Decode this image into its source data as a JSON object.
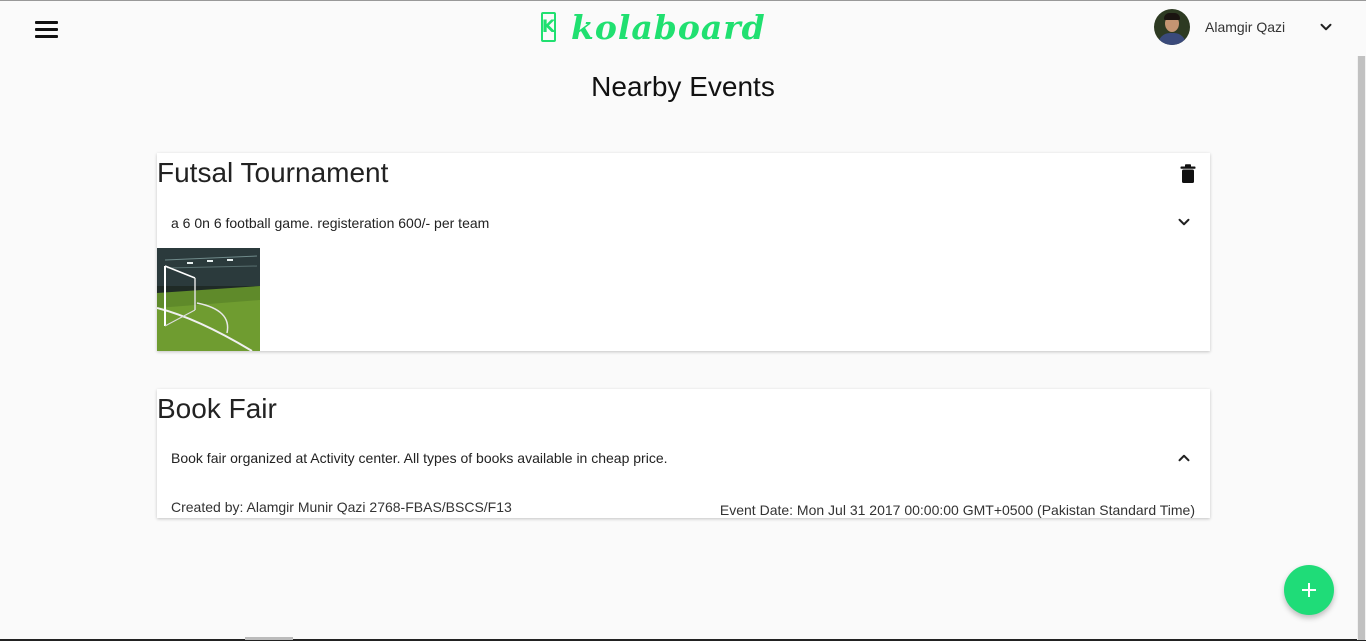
{
  "header": {
    "logo_mark": "K",
    "logo_text": "kolaboard",
    "user_name": "Alamgir Qazi",
    "menu_icon": "hamburger-menu-icon",
    "user_menu_icon": "chevron-down-icon"
  },
  "page": {
    "title": "Nearby Events"
  },
  "events": [
    {
      "title": "Futsal Tournament",
      "description": "a 6 0n 6 football game. registeration 600/- per team",
      "expanded": false,
      "has_image": true,
      "delete_icon": "trash-icon",
      "toggle_icon": "chevron-down-icon"
    },
    {
      "title": "Book Fair",
      "description": "Book fair organized at Activity center. All types of books available in cheap price.",
      "expanded": true,
      "created_by": "Created by: Alamgir Munir Qazi 2768-FBAS/BSCS/F13",
      "event_date": "Event Date: Mon Jul 31 2017 00:00:00 GMT+0500 (Pakistan Standard Time)",
      "toggle_icon": "chevron-up-icon"
    }
  ],
  "fab": {
    "icon": "plus-icon"
  },
  "colors": {
    "brand": "#20e070",
    "fab": "#1fdc78",
    "background": "#fafafa"
  }
}
